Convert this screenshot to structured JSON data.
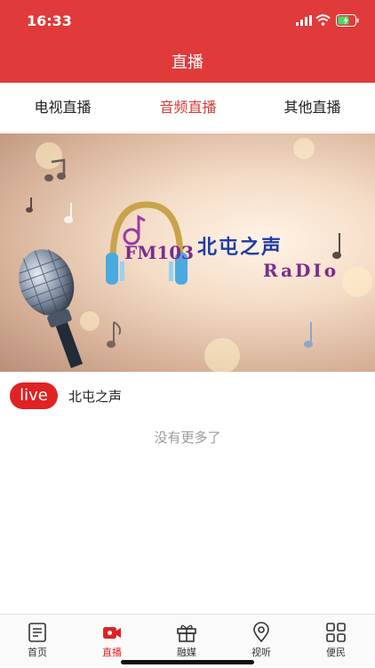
{
  "status_bar": {
    "time": "16:33"
  },
  "header": {
    "title": "直播"
  },
  "tabs": [
    {
      "label": "电视直播",
      "active": false
    },
    {
      "label": "音频直播",
      "active": true
    },
    {
      "label": "其他直播",
      "active": false
    }
  ],
  "banner": {
    "station_code": "FM103",
    "station_name": "北屯之声",
    "radio_text": "RaDIo"
  },
  "live_item": {
    "badge": "live",
    "name": "北屯之声"
  },
  "footer_note": "没有更多了",
  "tabbar": [
    {
      "label": "首页",
      "icon": "document-icon"
    },
    {
      "label": "直播",
      "icon": "video-camera-icon",
      "active": true
    },
    {
      "label": "融媒",
      "icon": "gift-icon"
    },
    {
      "label": "视听",
      "icon": "location-pin-icon"
    },
    {
      "label": "便民",
      "icon": "grid-icon"
    }
  ],
  "colors": {
    "brand": "#e03a3a",
    "live": "#e02222",
    "active_tab": "#d33a3a"
  }
}
